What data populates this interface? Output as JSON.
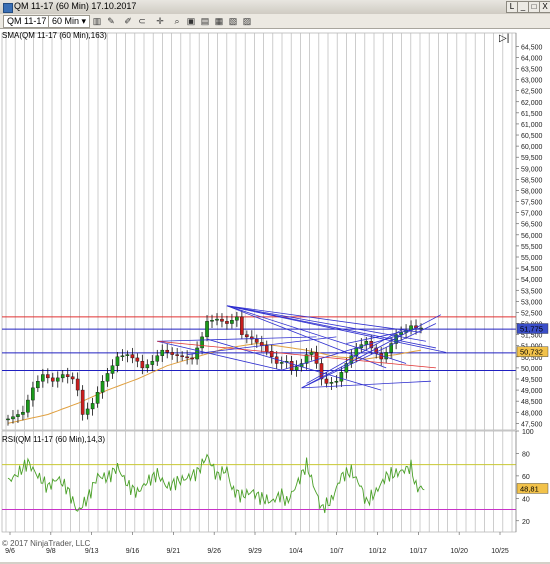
{
  "window": {
    "title": "QM 11-17 (60 Min)  17.10.2017",
    "buttons": [
      "L",
      "_",
      "□",
      "X"
    ]
  },
  "toolbar": {
    "instrument": "QM 11-17",
    "interval": "60 Min"
  },
  "chart_data": [
    {
      "type": "candlestick",
      "panel": "price",
      "indicator_label": "SMA(QM 11-17 (60 Min),163)",
      "ylim": [
        47.2,
        65.1
      ],
      "yticks": [
        47.5,
        48,
        48.5,
        49,
        49.5,
        50,
        50.5,
        51,
        51.5,
        52,
        52.5,
        53,
        53.5,
        54,
        54.5,
        55,
        55.5,
        56,
        56.5,
        57,
        57.5,
        58,
        58.5,
        59,
        59.5,
        60,
        60.5,
        61,
        61.5,
        62,
        62.5,
        63,
        63.5,
        64,
        64.5
      ],
      "ytick_labels": [
        "47,500",
        "48,000",
        "48,500",
        "49,000",
        "49,500",
        "50,000",
        "50,500",
        "51,000",
        "51,500",
        "52,000",
        "52,500",
        "53,000",
        "53,500",
        "54,000",
        "54,500",
        "55,000",
        "55,500",
        "56,000",
        "56,500",
        "57,000",
        "57,500",
        "58,000",
        "58,500",
        "59,000",
        "59,500",
        "60,000",
        "60,500",
        "61,000",
        "61,500",
        "62,000",
        "62,500",
        "63,000",
        "63,500",
        "64,000",
        "64,500"
      ],
      "x_ticks": [
        "9/6",
        "9/8",
        "9/13",
        "9/16",
        "9/21",
        "9/26",
        "9/29",
        "10/4",
        "10/7",
        "10/12",
        "10/17",
        "10/20",
        "10/25"
      ],
      "last_price": 51.775,
      "last_price_label": "51,775",
      "sma_value": 50.732,
      "sma_label": "50,732",
      "horizontal_levels": [
        {
          "value": 52.3,
          "color": "#e03030"
        },
        {
          "value": 51.75,
          "color": "#2020c0"
        },
        {
          "value": 50.68,
          "color": "#2020c0"
        },
        {
          "value": 49.88,
          "color": "#2020c0"
        }
      ],
      "close_path": [
        [
          0,
          47.7
        ],
        [
          3,
          48.0
        ],
        [
          5,
          49.1
        ],
        [
          7,
          49.7
        ],
        [
          9,
          49.4
        ],
        [
          11,
          49.7
        ],
        [
          13,
          49.5
        ],
        [
          14,
          49.0
        ],
        [
          15,
          47.9
        ],
        [
          17,
          48.4
        ],
        [
          19,
          49.4
        ],
        [
          21,
          50.1
        ],
        [
          22,
          50.5
        ],
        [
          24,
          50.6
        ],
        [
          26,
          50.3
        ],
        [
          27,
          50.0
        ],
        [
          29,
          50.3
        ],
        [
          31,
          50.8
        ],
        [
          33,
          50.6
        ],
        [
          35,
          50.5
        ],
        [
          37,
          50.4
        ],
        [
          39,
          51.4
        ],
        [
          40,
          52.1
        ],
        [
          42,
          52.2
        ],
        [
          44,
          52.0
        ],
        [
          46,
          52.3
        ],
        [
          47,
          51.5
        ],
        [
          49,
          51.3
        ],
        [
          51,
          51.0
        ],
        [
          53,
          50.5
        ],
        [
          54,
          50.2
        ],
        [
          56,
          50.3
        ],
        [
          57,
          49.9
        ],
        [
          59,
          50.2
        ],
        [
          60,
          50.6
        ],
        [
          61,
          50.7
        ],
        [
          62,
          50.2
        ],
        [
          63,
          49.5
        ],
        [
          64,
          49.3
        ],
        [
          66,
          49.4
        ],
        [
          68,
          50.2
        ],
        [
          70,
          50.9
        ],
        [
          72,
          51.2
        ],
        [
          73,
          50.9
        ],
        [
          75,
          50.4
        ],
        [
          76,
          50.7
        ],
        [
          78,
          51.5
        ],
        [
          80,
          51.7
        ],
        [
          81,
          51.9
        ],
        [
          82,
          51.8
        ],
        [
          83,
          51.8
        ]
      ],
      "sma_path": [
        [
          0,
          47.5
        ],
        [
          8,
          47.9
        ],
        [
          14,
          48.4
        ],
        [
          20,
          49.0
        ],
        [
          26,
          49.5
        ],
        [
          32,
          50.1
        ],
        [
          38,
          50.5
        ],
        [
          44,
          50.9
        ],
        [
          50,
          51.1
        ],
        [
          54,
          51.0
        ],
        [
          60,
          50.8
        ],
        [
          66,
          50.5
        ],
        [
          72,
          50.4
        ],
        [
          78,
          50.6
        ],
        [
          83,
          50.8
        ]
      ],
      "trend_lines": [
        {
          "from": [
            44,
            52.8
          ],
          "to": [
            83,
            51.6
          ],
          "color": "#3030d0"
        },
        {
          "from": [
            44,
            52.8
          ],
          "to": [
            84,
            51.2
          ],
          "color": "#3030d0"
        },
        {
          "from": [
            44,
            52.8
          ],
          "to": [
            86,
            50.9
          ],
          "color": "#3030d0"
        },
        {
          "from": [
            44,
            52.8
          ],
          "to": [
            88,
            50.7
          ],
          "color": "#3030d0"
        },
        {
          "from": [
            44,
            52.8
          ],
          "to": [
            80,
            50.2
          ],
          "color": "#3030d0"
        },
        {
          "from": [
            44,
            52.8
          ],
          "to": [
            76,
            50.0
          ],
          "color": "#3030d0"
        },
        {
          "from": [
            30,
            51.2
          ],
          "to": [
            55,
            49.9
          ],
          "color": "#3030d0"
        },
        {
          "from": [
            30,
            51.2
          ],
          "to": [
            62,
            51.4
          ],
          "color": "#3030d0"
        },
        {
          "from": [
            40,
            51.3
          ],
          "to": [
            75,
            49.0
          ],
          "color": "#3030d0"
        },
        {
          "from": [
            30,
            51.2
          ],
          "to": [
            86,
            50.0
          ],
          "color": "#e03030"
        },
        {
          "from": [
            59,
            49.1
          ],
          "to": [
            85,
            49.4
          ],
          "color": "#3030d0"
        },
        {
          "from": [
            59,
            49.1
          ],
          "to": [
            87,
            52.4
          ],
          "color": "#3030d0"
        },
        {
          "from": [
            59,
            49.1
          ],
          "to": [
            86,
            52.0
          ],
          "color": "#3030d0"
        },
        {
          "from": [
            60,
            49.3
          ],
          "to": [
            79,
            51.7
          ],
          "color": "#3030d0"
        },
        {
          "from": [
            55,
            49.9
          ],
          "to": [
            79,
            51.5
          ],
          "color": "#3030d0"
        },
        {
          "from": [
            36,
            50.6
          ],
          "to": [
            66,
            51.4
          ],
          "color": "#3030d0"
        },
        {
          "from": [
            68,
            51.1
          ],
          "to": [
            83,
            51.8
          ],
          "color": "#3030d0"
        }
      ]
    },
    {
      "type": "line",
      "panel": "rsi",
      "indicator_label": "RSI(QM 11-17 (60 Min),14,3)",
      "ylim": [
        10,
        100
      ],
      "yticks": [
        20,
        40,
        60,
        80,
        100
      ],
      "ytick_labels": [
        "20",
        "40",
        "60",
        "80",
        "100"
      ],
      "last_value": 48.81,
      "last_label": "48,81",
      "levels": [
        {
          "value": 70,
          "color": "#c8c832"
        },
        {
          "value": 30,
          "color": "#c832c8"
        }
      ],
      "rsi_path": [
        [
          0,
          55
        ],
        [
          2,
          62
        ],
        [
          4,
          72
        ],
        [
          6,
          60
        ],
        [
          8,
          50
        ],
        [
          10,
          58
        ],
        [
          12,
          48
        ],
        [
          14,
          28
        ],
        [
          16,
          40
        ],
        [
          18,
          60
        ],
        [
          20,
          58
        ],
        [
          22,
          68
        ],
        [
          24,
          52
        ],
        [
          26,
          45
        ],
        [
          28,
          55
        ],
        [
          30,
          62
        ],
        [
          32,
          50
        ],
        [
          34,
          55
        ],
        [
          36,
          58
        ],
        [
          38,
          63
        ],
        [
          40,
          78
        ],
        [
          42,
          60
        ],
        [
          44,
          66
        ],
        [
          45,
          48
        ],
        [
          47,
          42
        ],
        [
          49,
          46
        ],
        [
          51,
          40
        ],
        [
          53,
          37
        ],
        [
          55,
          44
        ],
        [
          56,
          36
        ],
        [
          58,
          52
        ],
        [
          60,
          70
        ],
        [
          62,
          44
        ],
        [
          63,
          31
        ],
        [
          65,
          38
        ],
        [
          67,
          60
        ],
        [
          69,
          64
        ],
        [
          71,
          50
        ],
        [
          72,
          36
        ],
        [
          74,
          46
        ],
        [
          76,
          60
        ],
        [
          78,
          62
        ],
        [
          80,
          66
        ],
        [
          81,
          68
        ],
        [
          82,
          50
        ],
        [
          83,
          49
        ]
      ],
      "bar_count": 84
    }
  ],
  "copyright": "© 2017 NinjaTrader, LLC"
}
